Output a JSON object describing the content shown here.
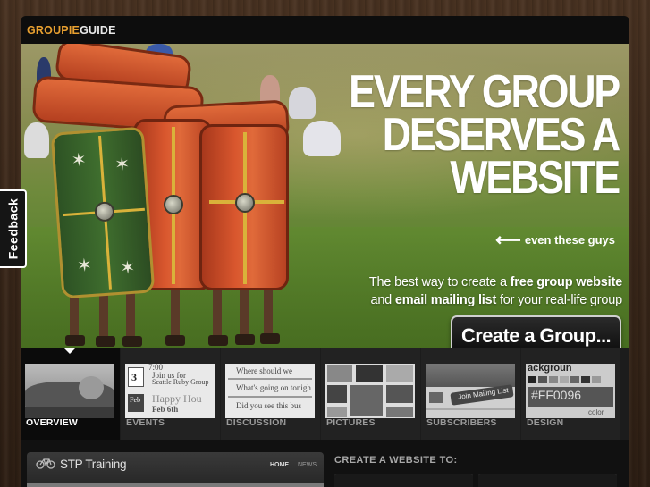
{
  "feedback": {
    "label": "Feedback"
  },
  "logo": {
    "part1": "GROUPIE",
    "part2": "GUIDE"
  },
  "hero": {
    "headline_line1": "EVERY GROUP",
    "headline_line2": "DESERVES A",
    "headline_line3": "WEBSITE",
    "subtag_arrow": "⟵",
    "subtag": "even these guys",
    "tagline_1a": "The best way to create a ",
    "tagline_1b": "free group website",
    "tagline_2a": "and ",
    "tagline_2b": "email mailing list",
    "tagline_2c": " for your real-life group",
    "cta_label": "Create a Group..."
  },
  "features": [
    {
      "label": "OVERVIEW"
    },
    {
      "label": "EVENTS"
    },
    {
      "label": "DISCUSSION"
    },
    {
      "label": "PICTURES"
    },
    {
      "label": "SUBSCRIBERS"
    },
    {
      "label": "DESIGN"
    }
  ],
  "thumbs": {
    "events_num": "3",
    "events_feb": "Feb",
    "events_time": "7:00",
    "events_join": "Join us for",
    "events_ruby": "Seattle Ruby Group",
    "events_happy": "Happy Hou",
    "events_feb6": "Feb 6th",
    "discussion_1": "Where should we",
    "discussion_2": "What's going on tonigh",
    "discussion_3": "Did you see this bus",
    "subscribers_label": "Join Mailing List",
    "design_word": "ackgroun",
    "design_hex": "#FF0096",
    "design_color": "color"
  },
  "preview": {
    "brand": "STP Training",
    "nav_home": "HOME",
    "nav_news": "NEWS"
  },
  "create_website": {
    "title": "CREATE A WEBSITE TO:"
  },
  "colors": {
    "logo_accent": "#e8a030",
    "wood": "#3b281a"
  }
}
